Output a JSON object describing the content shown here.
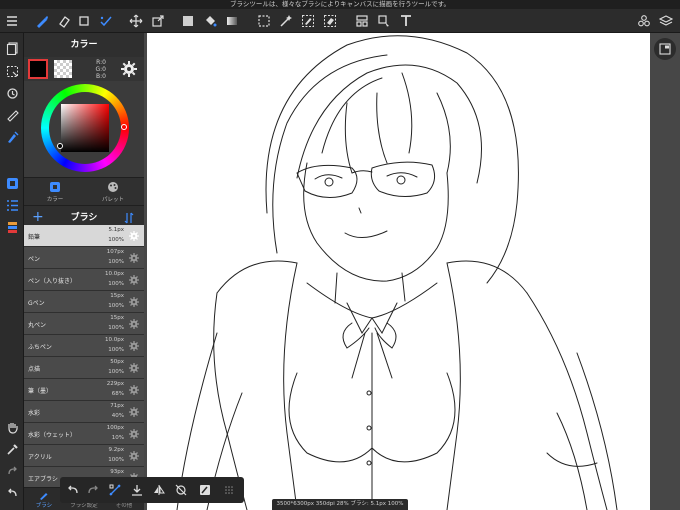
{
  "notice": "ブラシツールは、様々なブラシによりキャンバスに描画を行うツールです。",
  "color_panel": {
    "title": "カラー",
    "rgb": [
      "R:0",
      "G:0",
      "B:0"
    ],
    "main_color": "#000000",
    "tabs": [
      {
        "label": "カラー",
        "active": true
      },
      {
        "label": "パレット",
        "active": false
      }
    ]
  },
  "brush_panel": {
    "title": "ブラシ",
    "items": [
      {
        "name": "鉛筆",
        "size": "5.1px",
        "opacity": "100%",
        "selected": true
      },
      {
        "name": "ペン",
        "size": "107px",
        "opacity": "100%",
        "selected": false
      },
      {
        "name": "ペン（入り抜き）",
        "size": "10.0px",
        "opacity": "100%",
        "selected": false
      },
      {
        "name": "Gペン",
        "size": "15px",
        "opacity": "100%",
        "selected": false
      },
      {
        "name": "丸ペン",
        "size": "15px",
        "opacity": "100%",
        "selected": false
      },
      {
        "name": "ふちペン",
        "size": "10.0px",
        "opacity": "100%",
        "selected": false
      },
      {
        "name": "点描",
        "size": "50px",
        "opacity": "100%",
        "selected": false
      },
      {
        "name": "筆（墨）",
        "size": "229px",
        "opacity": "68%",
        "selected": false
      },
      {
        "name": "水彩",
        "size": "71px",
        "opacity": "40%",
        "selected": false
      },
      {
        "name": "水彩（ウェット）",
        "size": "100px",
        "opacity": "10%",
        "selected": false
      },
      {
        "name": "アクリル",
        "size": "9.2px",
        "opacity": "100%",
        "selected": false
      },
      {
        "name": "エアブラシ",
        "size": "93px",
        "opacity": "",
        "selected": false
      }
    ],
    "bottom_tabs": [
      {
        "label": "ブラシ",
        "active": true
      },
      {
        "label": "ブラシ設定",
        "active": false
      },
      {
        "label": "その他",
        "active": false
      }
    ]
  },
  "status_text": "3500*6300px 350dpi 28% ブラシ: 5.1px 100%",
  "icons": {
    "accent": "#3d8bff",
    "selection_red": "#e33a3a"
  }
}
